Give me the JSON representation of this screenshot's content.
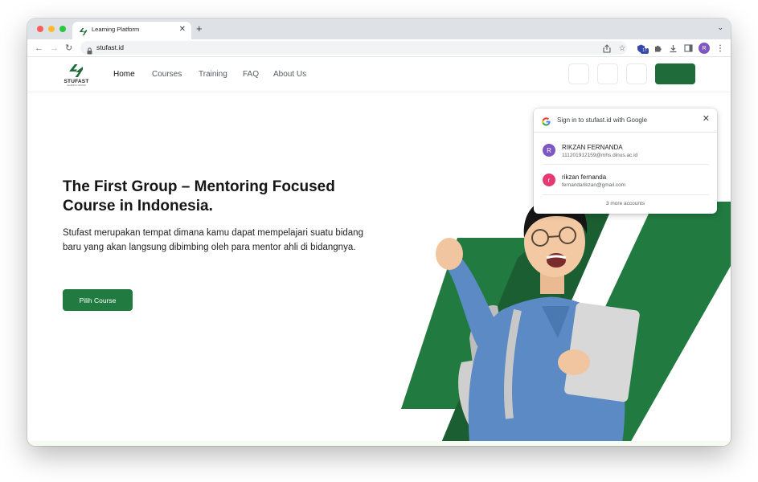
{
  "browser": {
    "tab": {
      "title": "Learning Platform",
      "close": "✕"
    },
    "new_tab": "+",
    "tabstrip_menu": "⌄",
    "url": "stufast.id",
    "extension_badge": "17",
    "profile_initial": "R"
  },
  "site": {
    "brand": {
      "name": "STUFAST",
      "tagline": "LEARNING CENTER"
    },
    "nav": [
      {
        "label": "Home",
        "active": true
      },
      {
        "label": "Courses"
      },
      {
        "label": "Training"
      },
      {
        "label": "FAQ"
      },
      {
        "label": "About Us"
      }
    ],
    "hero": {
      "title": "The First Group – Mentoring Focused Course in Indonesia.",
      "description": "Stufast merupakan tempat dimana kamu dapat mempelajari suatu bidang baru yang akan langsung dibimbing oleh para mentor ahli di bidangnya.",
      "cta": "Pilih Course"
    },
    "accent_color": "#217a40"
  },
  "google_signin": {
    "title": "Sign in to stufast.id with Google",
    "close": "✕",
    "accounts": [
      {
        "initial": "R",
        "name": "RIKZAN FERNANDA",
        "email": "111201912159@mhs.dinus.ac.id",
        "color": "#7e57c2"
      },
      {
        "initial": "r",
        "name": "rikzan fernanda",
        "email": "fernandarikzan@gmail.com",
        "color": "#e53970"
      }
    ],
    "more_accounts": "3 more accounts"
  }
}
